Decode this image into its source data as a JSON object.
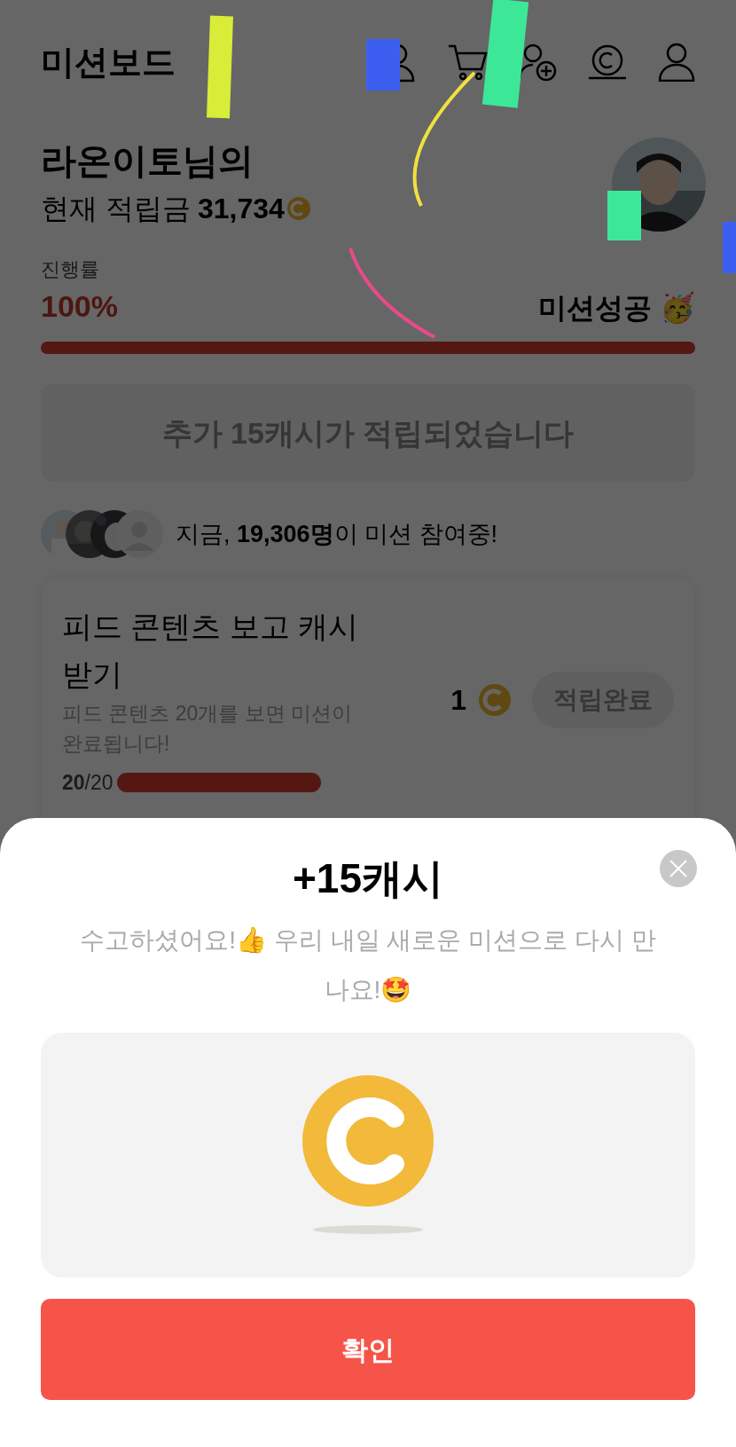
{
  "header": {
    "title": "미션보드"
  },
  "profile": {
    "name": "라온이토님의",
    "balance_label": "현재 적립금",
    "balance": "31,734"
  },
  "progress": {
    "label": "진행률",
    "value": "100%",
    "status": "미션성공 🥳",
    "level": 1
  },
  "banner": {
    "text": "추가 15캐시가 적립되었습니다"
  },
  "participants": {
    "text": "지금, **19,306명**이 미션 참여중!"
  },
  "mission": {
    "title": "피드 콘텐츠 보고 캐시 받기",
    "description": "피드 콘텐츠 20개를 보면 미션이 완료됩니다!",
    "count": "**20**/20",
    "level": 1,
    "reward": "1",
    "button": "적립완료",
    "disabled": true
  },
  "sheet": {
    "title": "+15캐시",
    "message": "수고하셨어요!👍 우리 내일 새로운 미션으로 다시 만나요!🤩",
    "confirm": "확인"
  }
}
